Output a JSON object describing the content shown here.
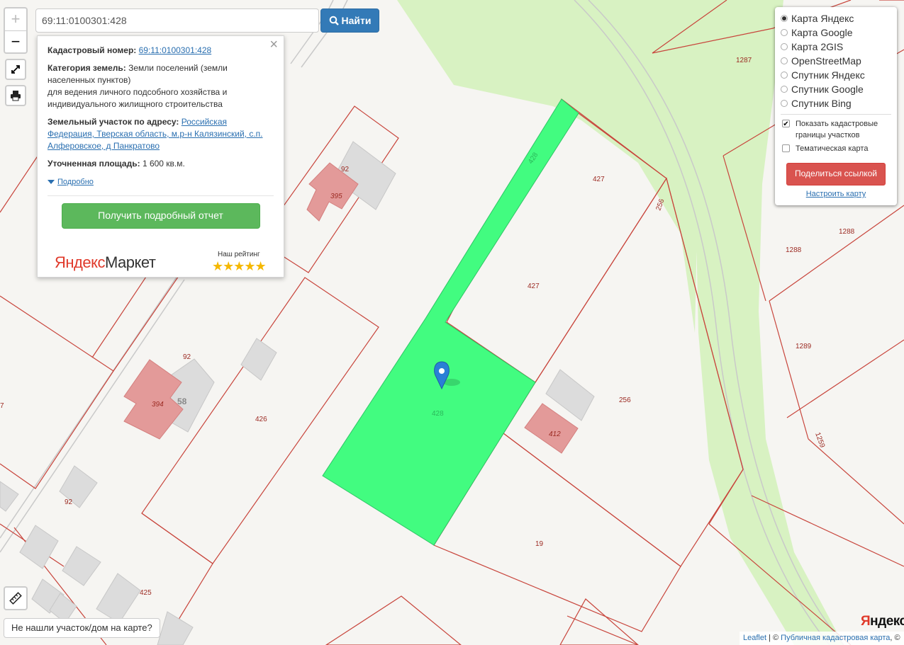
{
  "search": {
    "value": "69:11:0100301:428",
    "button_label": "Найти"
  },
  "zoom": {
    "in": "+",
    "out": "−"
  },
  "popup": {
    "cad_label": "Кадастровый номер:",
    "cad_value": "69:11:0100301:428",
    "category_label": "Категория земель:",
    "category_value": "Земли поселений (земли населенных пунктов)",
    "purpose": "для ведения личного подсобного хозяйства и индивидуального жилищного строительства",
    "address_label": "Земельный участок по адресу:",
    "address_value": "Российская Федерация, Тверская область, м.р-н Калязинский, с.п. Алферовское, д Панкратово",
    "area_label": "Уточненная площадь:",
    "area_value": "1 600 кв.м.",
    "more_label": "Подробно",
    "report_button": "Получить подробный отчет",
    "market_brand_a": "Яндекс",
    "market_brand_b": "Маркет",
    "rating_label": "Наш рейтинг",
    "stars": "★★★★★"
  },
  "layers": {
    "options": [
      "Карта Яндекс",
      "Карта Google",
      "Карта 2GIS",
      "OpenStreetMap",
      "Спутник Яндекс",
      "Спутник Google",
      "Спутник Bing"
    ],
    "selected": "Карта Яндекс",
    "show_borders": "Показать кадастровые границы участков",
    "thematic": "Тематическая карта",
    "share_button": "Поделиться ссылкой",
    "setup_link": "Настроить карту"
  },
  "not_found": "Не нашли участок/дом на карте?",
  "yandex_logo": {
    "a": "Я",
    "b": "ндекс"
  },
  "attribution": {
    "leaflet": "Leaflet",
    "sep": " | © ",
    "pkk": "Публичная кадастровая карта",
    "tail": ", ©"
  },
  "map_labels": {
    "l1287": "1287",
    "l427a": "427",
    "l427b": "427",
    "l256a": "256",
    "l256b": "256",
    "l1288a": "1288",
    "l1288b": "1288",
    "l1289": "1289",
    "l1259": "1259",
    "l428a": "428",
    "l428b": "428",
    "l92a": "92",
    "l92b": "92",
    "l92c": "92",
    "l395": "395",
    "l394": "394",
    "l58": "58",
    "l426": "426",
    "l412": "412",
    "l19": "19",
    "l425": "425",
    "l7": "7"
  },
  "colors": {
    "selected_parcel": "#42fc80",
    "parcel_border": "#c8453c",
    "green_area": "#d8f2c2",
    "building": "#e39a99"
  }
}
